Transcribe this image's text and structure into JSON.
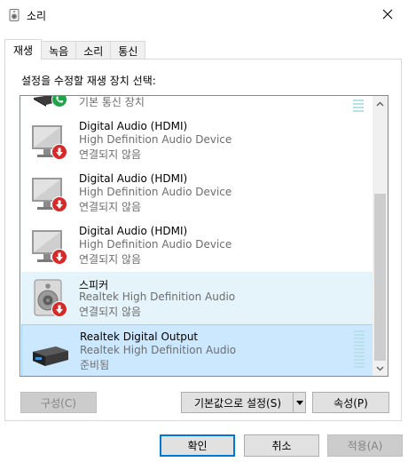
{
  "window": {
    "title": "소리"
  },
  "tabs": [
    {
      "label": "재생"
    },
    {
      "label": "녹음"
    },
    {
      "label": "소리"
    },
    {
      "label": "통신"
    }
  ],
  "panel": {
    "prompt": "설정을 수정할 재생 장치 선택:"
  },
  "devices": [
    {
      "name": "",
      "description": "",
      "status": "기본 통신 장치",
      "icon": "phone-device-icon",
      "badge": "green-phone-check"
    },
    {
      "name": "Digital Audio (HDMI)",
      "description": "High Definition Audio Device",
      "status": "연결되지 않음",
      "icon": "monitor-icon",
      "badge": "red-down-arrow"
    },
    {
      "name": "Digital Audio (HDMI)",
      "description": "High Definition Audio Device",
      "status": "연결되지 않음",
      "icon": "monitor-icon",
      "badge": "red-down-arrow"
    },
    {
      "name": "Digital Audio (HDMI)",
      "description": "High Definition Audio Device",
      "status": "연결되지 않음",
      "icon": "monitor-icon",
      "badge": "red-down-arrow"
    },
    {
      "name": "스피커",
      "description": "Realtek High Definition Audio",
      "status": "연결되지 않음",
      "icon": "speaker-icon",
      "badge": "red-down-arrow"
    },
    {
      "name": "Realtek Digital Output",
      "description": "Realtek High Definition Audio",
      "status": "준비됨",
      "icon": "digital-output-icon",
      "badge": ""
    }
  ],
  "buttons": {
    "configure": "구성(C)",
    "set_default": "기본값으로 설정(S)",
    "properties": "속성(P)",
    "ok": "확인",
    "cancel": "취소",
    "apply": "적용(A)"
  },
  "colors": {
    "selected_bg": "#cce8ff",
    "hover_bg": "#e5f3fb",
    "accent": "#0078d7",
    "disconnected_badge": "#d42a2a",
    "phone_badge": "#21a34a"
  }
}
